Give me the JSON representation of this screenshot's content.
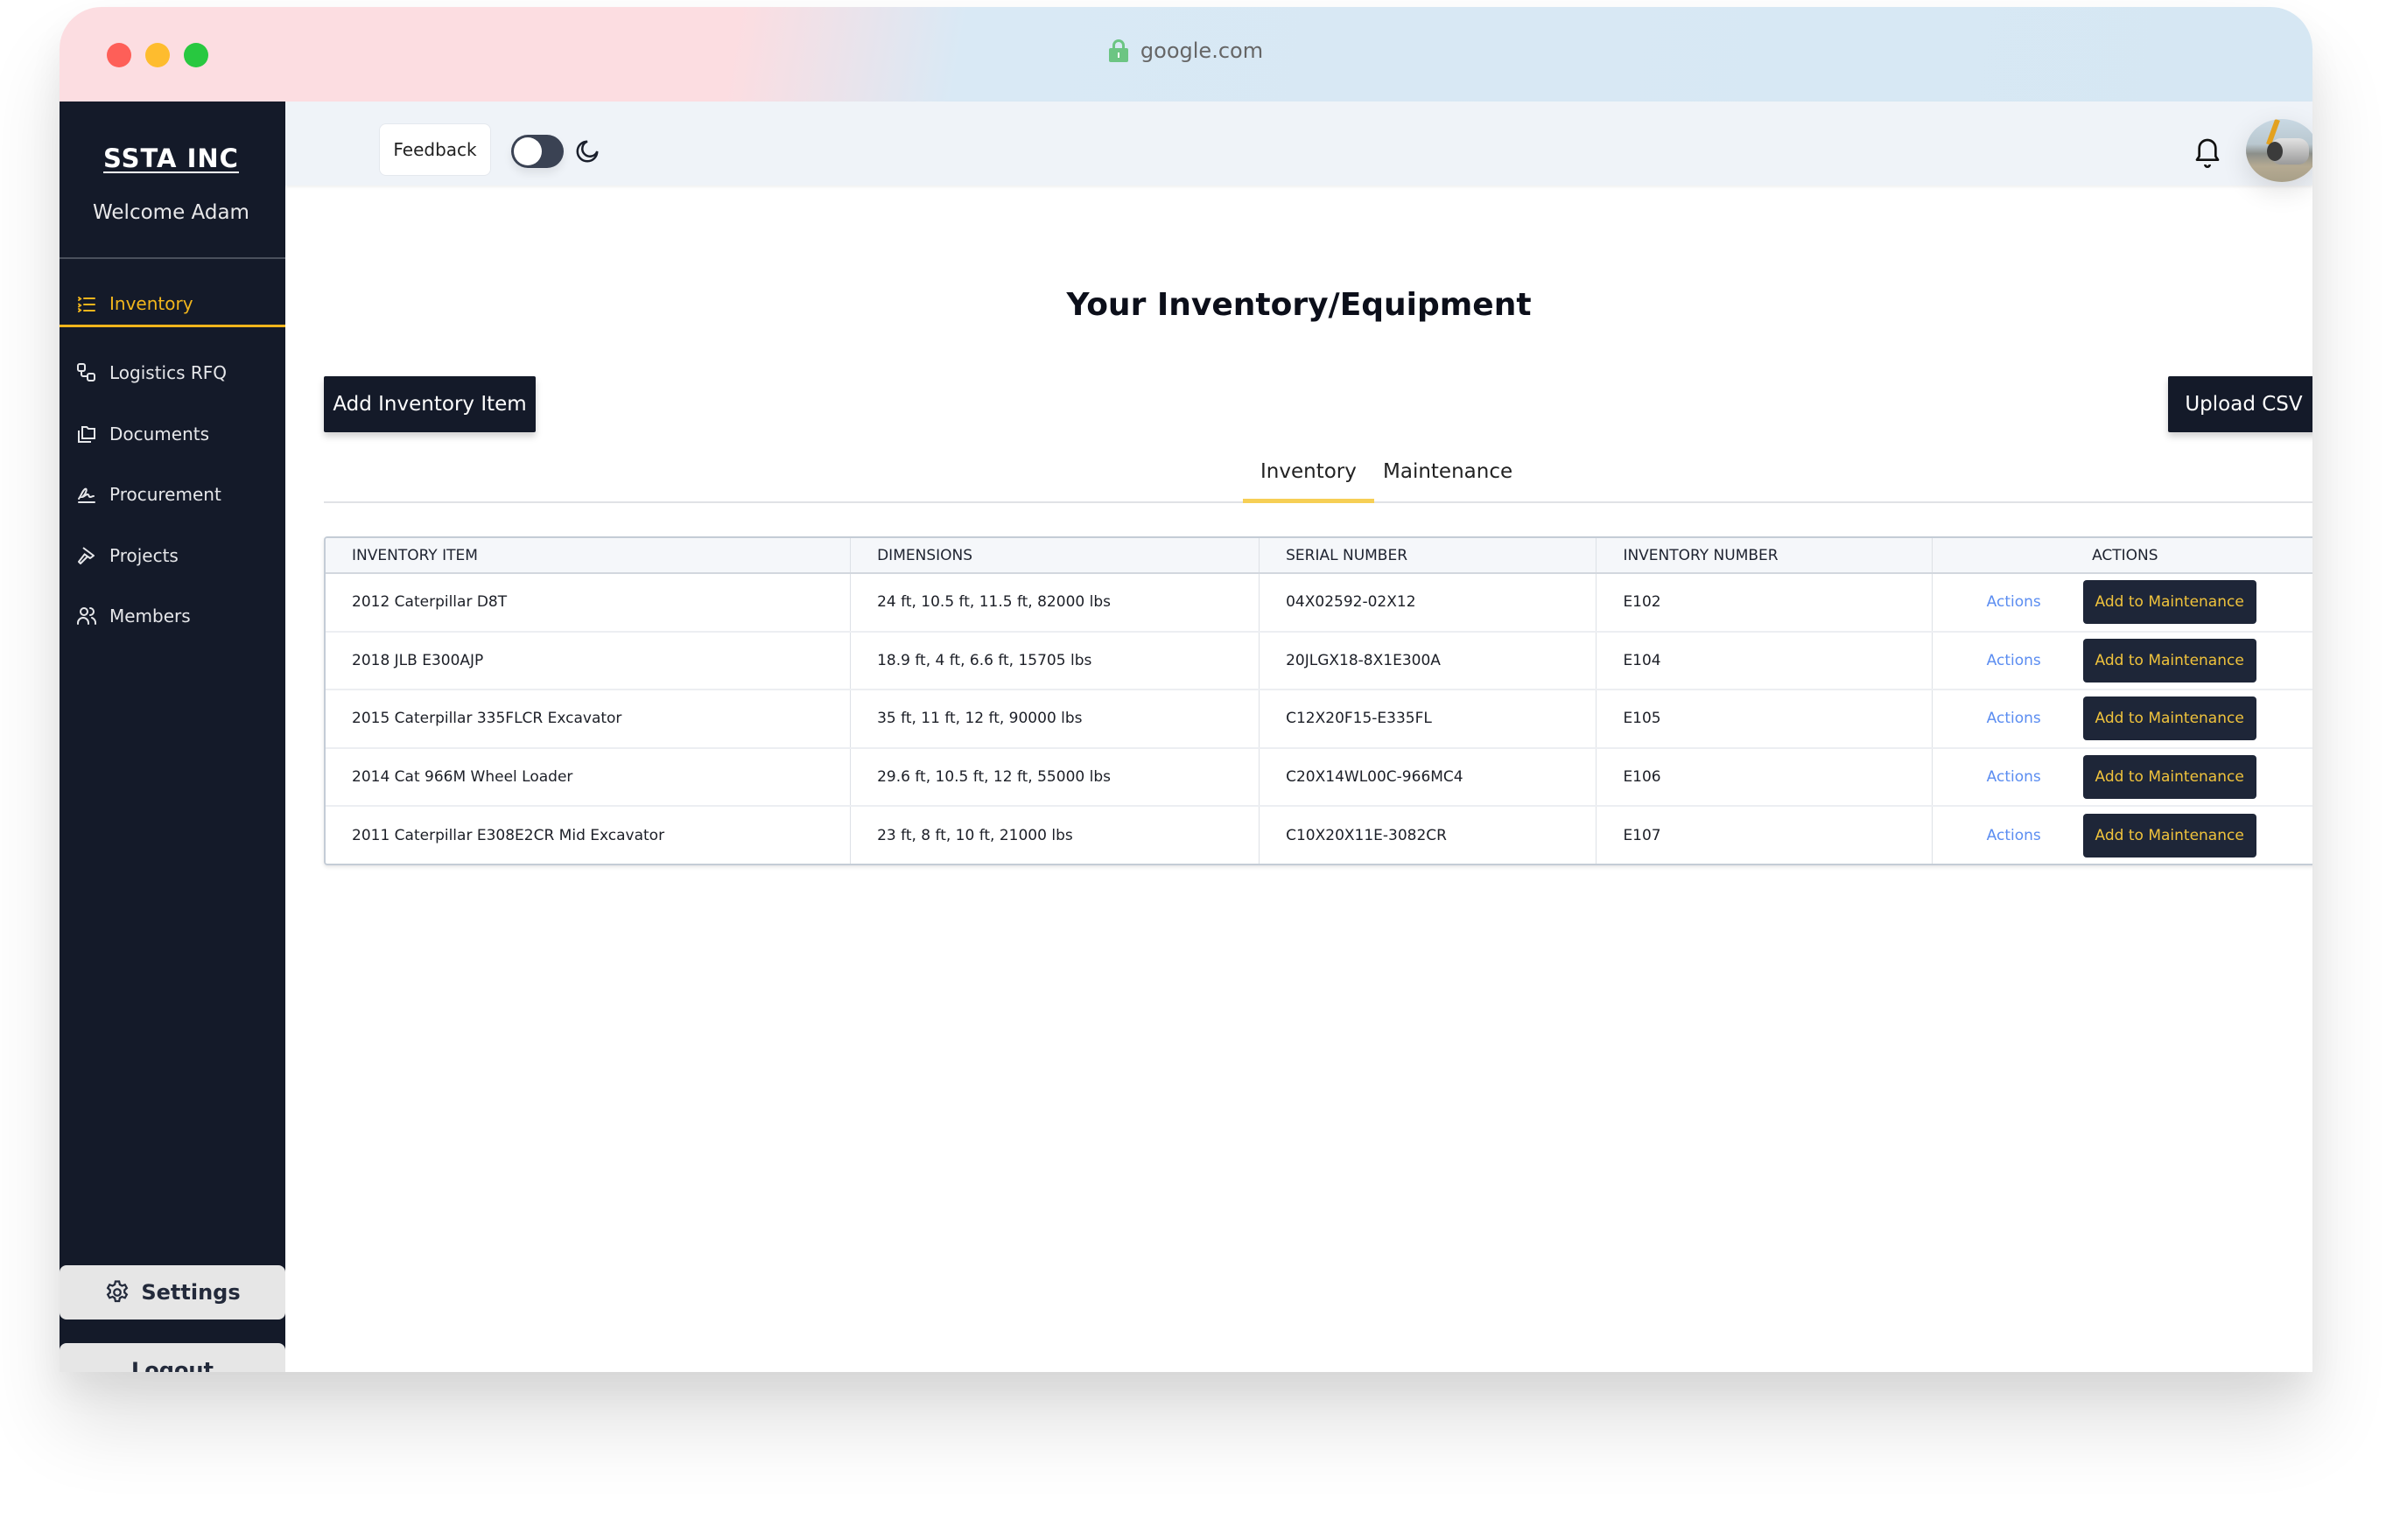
{
  "browser": {
    "url": "google.com",
    "lock_icon": "lock-icon"
  },
  "sidebar": {
    "brand": "SSTA INC",
    "welcome": "Welcome Adam",
    "items": [
      {
        "label": "Inventory",
        "icon": "list-icon",
        "active": true
      },
      {
        "label": "Logistics RFQ",
        "icon": "flow-icon",
        "active": false
      },
      {
        "label": "Documents",
        "icon": "folders-icon",
        "active": false
      },
      {
        "label": "Procurement",
        "icon": "signature-icon",
        "active": false
      },
      {
        "label": "Projects",
        "icon": "hammer-icon",
        "active": false
      },
      {
        "label": "Members",
        "icon": "users-icon",
        "active": false
      }
    ],
    "settings_label": "Settings",
    "logout_label": "Logout"
  },
  "header": {
    "feedback_label": "Feedback",
    "theme_toggle": "off",
    "theme_icon": "moon-icon",
    "notification_icon": "bell-icon",
    "avatar": "user-avatar"
  },
  "main": {
    "title": "Your Inventory/Equipment",
    "add_button": "Add Inventory Item",
    "upload_button": "Upload CSV",
    "tabs": [
      {
        "label": "Inventory",
        "active": true
      },
      {
        "label": "Maintenance",
        "active": false
      }
    ],
    "table": {
      "columns": [
        "INVENTORY ITEM",
        "DIMENSIONS",
        "SERIAL NUMBER",
        "INVENTORY NUMBER",
        "ACTIONS"
      ],
      "rows": [
        {
          "item": "2012 Caterpillar D8T",
          "dimensions": "24 ft, 10.5 ft, 11.5 ft, 82000 lbs",
          "serial": "04X02592-02X12",
          "inv_no": "E102",
          "actions_label": "Actions",
          "maint_label": "Add to Maintenance"
        },
        {
          "item": "2018 JLB E300AJP",
          "dimensions": "18.9 ft, 4 ft, 6.6 ft, 15705 lbs",
          "serial": "20JLGX18-8X1E300A",
          "inv_no": "E104",
          "actions_label": "Actions",
          "maint_label": "Add to Maintenance"
        },
        {
          "item": "2015 Caterpillar 335FLCR Excavator",
          "dimensions": "35 ft, 11 ft, 12 ft, 90000 lbs",
          "serial": "C12X20F15-E335FL",
          "inv_no": "E105",
          "actions_label": "Actions",
          "maint_label": "Add to Maintenance"
        },
        {
          "item": "2014 Cat 966M Wheel Loader",
          "dimensions": "29.6 ft, 10.5 ft, 12 ft, 55000 lbs",
          "serial": "C20X14WL00C-966MC4",
          "inv_no": "E106",
          "actions_label": "Actions",
          "maint_label": "Add to Maintenance"
        },
        {
          "item": "2011 Caterpillar E308E2CR Mid Excavator",
          "dimensions": "23 ft, 8 ft, 10 ft, 21000 lbs",
          "serial": "C10X20X11E-3082CR",
          "inv_no": "E107",
          "actions_label": "Actions",
          "maint_label": "Add to Maintenance"
        }
      ]
    }
  },
  "colors": {
    "sidebar_bg": "#141a29",
    "accent": "#f1b51c",
    "link": "#5b8df1",
    "button_dark": "#1e2638"
  }
}
